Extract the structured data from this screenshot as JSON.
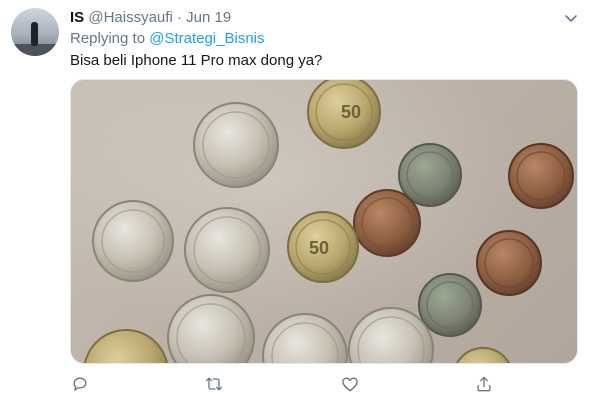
{
  "tweet": {
    "display_name": "IS",
    "handle": "@Haissyaufi",
    "separator": "·",
    "date": "Jun 19",
    "replying_prefix": "Replying to",
    "replying_to": "@Strategi_Bisnis",
    "text": "Bisa beli Iphone 11 Pro max dong ya?"
  },
  "media": {
    "coin_marks": [
      "50",
      "50"
    ]
  },
  "colors": {
    "accent": "#1da1f2",
    "secondary_text": "#657786",
    "primary_text": "#14171a"
  },
  "icons": [
    "caret-down-icon",
    "reply-icon",
    "retweet-icon",
    "like-icon",
    "share-icon"
  ]
}
